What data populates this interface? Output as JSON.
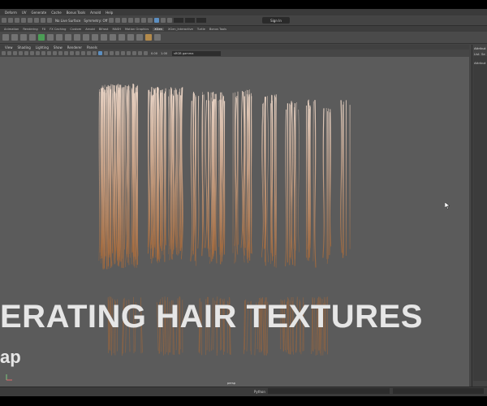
{
  "menubar": [
    "Deform",
    "UV",
    "Generate",
    "Cache",
    "Bonus Tools",
    "Arnold",
    "Help"
  ],
  "status": {
    "live_surface": "No Live Surface",
    "symmetry": "Symmetry: Off",
    "sign_in": "Sign In"
  },
  "shelf_tabs": [
    "Animation",
    "Rendering",
    "FX",
    "FX Caching",
    "Custom",
    "Arnold",
    "Bifrost",
    "MASH",
    "Motion Graphics",
    "XGen",
    "XGen_Interactive",
    "Turtle",
    "Bonus Tools"
  ],
  "active_shelf_tab": "XGen",
  "viewport_menu": [
    "View",
    "Shading",
    "Lighting",
    "Show",
    "Renderer",
    "Panels"
  ],
  "viewport_toolbar": {
    "num1": "0.00",
    "num2": "1.00",
    "color_space": "sRGB gamma"
  },
  "sidepanel": {
    "title": "Attribut",
    "tab1": "List",
    "tab2": "Se",
    "sub": "Attribut"
  },
  "viewport_label": "persp",
  "overlay": {
    "title": "ERATING HAIR TEXTURES",
    "subtitle": "ap"
  },
  "command_line": {
    "label": "Python"
  },
  "colors": {
    "hair_light": "#e9d3c4",
    "hair_root": "#a3683a",
    "viewport_bg": "#5b5b5b"
  }
}
